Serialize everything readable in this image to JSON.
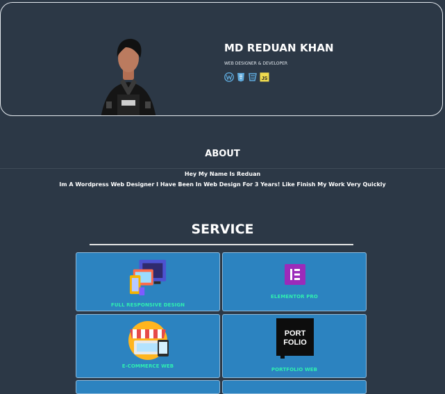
{
  "profile": {
    "name": "MD REDUAN KHAN",
    "role": "WEB DESIGNER & DEVELOPER",
    "tech_icons": [
      "wordpress-icon",
      "html5-icon",
      "css3-icon",
      "javascript-icon"
    ],
    "js_label": "JS"
  },
  "about": {
    "title": "ABOUT",
    "line1": "Hey My Name Is Reduan",
    "line2": "Im A Wordpress Web Designer I Have Been In Web Design For 3 Years! Like Finish My Work Very Quickly"
  },
  "service": {
    "title": "SERVICE",
    "cards": [
      {
        "label": "FULL RESPONSIVE DESIGN",
        "icon": "responsive-devices-icon"
      },
      {
        "label": "ELEMENTOR PRO",
        "icon": "elementor-icon"
      },
      {
        "label": "E-COMMERCE WEB",
        "icon": "ecommerce-store-icon"
      },
      {
        "label": "PORTFOLIO WEB",
        "icon": "portfolio-icon",
        "icon_text_1": "PORT",
        "icon_text_2": "FOLIO"
      }
    ]
  },
  "colors": {
    "background": "#2c3846",
    "card": "#2c83c0",
    "card_label": "#2ff0b0"
  }
}
